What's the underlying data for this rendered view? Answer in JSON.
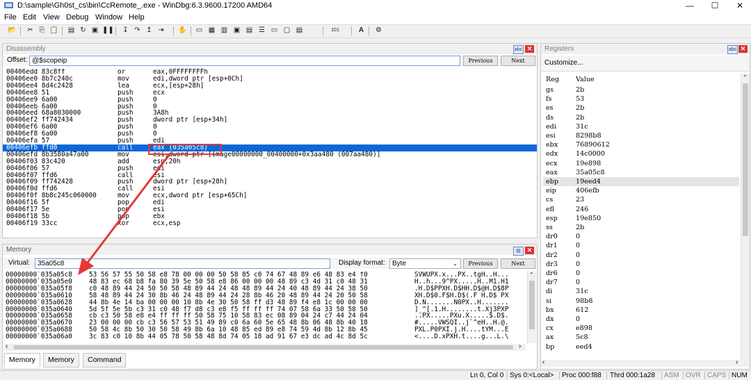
{
  "window": {
    "title": "D:\\sample\\Gh0st_cs\\bin\\CcRemote_.exe - WinDbg:6.3.9600.17200 AMD64",
    "minimize": "—",
    "maximize": "☐",
    "close": "✕"
  },
  "menu": [
    "File",
    "Edit",
    "View",
    "Debug",
    "Window",
    "Help"
  ],
  "toolbar": {
    "icons": [
      "open-icon",
      "cut-icon",
      "copy-icon",
      "paste-icon",
      "go-icon",
      "restart-icon",
      "stop-icon",
      "break-icon",
      "step-into-icon",
      "step-over-icon",
      "step-out-icon",
      "run-to-cursor-icon",
      "hand-icon",
      "command-window-icon",
      "watch-window-icon",
      "locals-window-icon",
      "registers-window-icon",
      "memory-window-icon",
      "call-stack-icon",
      "disassembly-icon",
      "scratch-pad-icon",
      "process-threads-icon",
      "source-mode-icon",
      "font-icon",
      "options-icon"
    ],
    "source_mode_label": "101",
    "font_label": "A",
    "options_label": "⚙"
  },
  "disassembly": {
    "header": "Disassembly",
    "offset_label": "Offset:",
    "offset_value": "@$scopeip",
    "previous": "Previous",
    "next": "Next",
    "selected_index": 11,
    "callout_text": "eax {035a05c8}",
    "lines": [
      {
        "addr": "00406edd 83c8ff",
        "mn": "or",
        "op": "eax,0FFFFFFFFh"
      },
      {
        "addr": "00406ee0 8b7c240c",
        "mn": "mov",
        "op": "edi,dword ptr [esp+0Ch]"
      },
      {
        "addr": "00406ee4 8d4c2428",
        "mn": "lea",
        "op": "ecx,[esp+28h]"
      },
      {
        "addr": "00406ee8 51",
        "mn": "push",
        "op": "ecx"
      },
      {
        "addr": "00406ee9 6a00",
        "mn": "push",
        "op": "0"
      },
      {
        "addr": "00406eeb 6a00",
        "mn": "push",
        "op": "0"
      },
      {
        "addr": "00406eed 68a8030000",
        "mn": "push",
        "op": "3A8h"
      },
      {
        "addr": "00406ef2 ff742434",
        "mn": "push",
        "op": "dword ptr [esp+34h]"
      },
      {
        "addr": "00406ef6 6a00",
        "mn": "push",
        "op": "0"
      },
      {
        "addr": "00406ef8 6a00",
        "mn": "push",
        "op": "0"
      },
      {
        "addr": "00406efa 57",
        "mn": "push",
        "op": "edi"
      },
      {
        "addr": "00406efb ffd0",
        "mn": "call",
        "op": "eax {035a05c8}"
      },
      {
        "addr": "00406efd 8b3580a47a00",
        "mn": "mov",
        "op": "esi,dword ptr [image00000000_00400000+0x3aa480 (007aa480)]"
      },
      {
        "addr": "00406f03 83c420",
        "mn": "add",
        "op": "esp,20h"
      },
      {
        "addr": "00406f06 57",
        "mn": "push",
        "op": "edi"
      },
      {
        "addr": "00406f07 ffd6",
        "mn": "call",
        "op": "esi"
      },
      {
        "addr": "00406f09 ff742428",
        "mn": "push",
        "op": "dword ptr [esp+28h]"
      },
      {
        "addr": "00406f0d ffd6",
        "mn": "call",
        "op": "esi"
      },
      {
        "addr": "00406f0f 8b8c245c060000",
        "mn": "mov",
        "op": "ecx,dword ptr [esp+65Ch]"
      },
      {
        "addr": "00406f16 5f",
        "mn": "pop",
        "op": "edi"
      },
      {
        "addr": "00406f17 5e",
        "mn": "pop",
        "op": "esi"
      },
      {
        "addr": "00406f18 5b",
        "mn": "pop",
        "op": "ebx"
      },
      {
        "addr": "00406f19 33cc",
        "mn": "xor",
        "op": "ecx,esp"
      }
    ]
  },
  "memory": {
    "header": "Memory",
    "virtual_label": "Virtual:",
    "virtual_value": "35a05c8",
    "display_format_label": "Display format:",
    "display_format_value": "Byte",
    "previous": "Previous",
    "next": "Next",
    "rows": [
      {
        "addr": "00000000`035a05c8",
        "hex": "53 56 57 55 50 58 e8 78 00 00 00 50 58 85 c0 74 67 48 89 e6 48 83 e4 f0",
        "ascii": "SVWUPX.x...PX..tgH..H..."
      },
      {
        "addr": "00000000`035a05e0",
        "hex": "48 83 ec 68 b8 fa 80 39 5e 50 58 e8 86 00 00 00 48 89 c3 4d 31 c0 48 31",
        "ascii": "H..h...9^PX.....H..M1.H1"
      },
      {
        "addr": "00000000`035a05f8",
        "hex": "c0 48 89 44 24 50 50 58 48 89 44 24 48 48 89 44 24 40 48 89 44 24 38 50",
        "ascii": ".H.D$PPXH.D$HH.D$@H.D$8P"
      },
      {
        "addr": "00000000`035a0610",
        "hex": "58 48 89 44 24 30 8b 46 24 48 89 44 24 28 8b 46 20 48 89 44 24 20 50 58",
        "ascii": "XH.D$0.F$H.D$(.F H.D$ PX"
      },
      {
        "addr": "00000000`035a0628",
        "hex": "44 8b 4e 14 ba 00 00 00 10 8b 4e 30 50 58 ff d3 48 89 f4 e8 1c 00 00 00",
        "ascii": "D.N.......N0PX..H......."
      },
      {
        "addr": "00000000`035a0640",
        "hex": "5d 5f 5e 5b c3 31 c0 48 f7 d8 c3 e8 f5 ff ff ff 74 07 58 6a 33 50 58 50",
        "ascii": "]_^[.1.H........t.Xj3PXP"
      },
      {
        "addr": "00000000`035a0658",
        "hex": "cb c3 50 58 e8 e4 ff ff ff 50 58 75 10 58 83 ec 08 89 04 24 c7 44 24 04",
        "ascii": "..PX.....PXu.X.....$.D$."
      },
      {
        "addr": "00000000`035a0670",
        "hex": "23 00 00 00 cb c3 56 57 53 51 49 89 c0 6a 60 5e 65 48 8b 06 48 8b 40 18",
        "ascii": "#.....VWSQI..j`^eH..H.@."
      },
      {
        "addr": "00000000`035a0688",
        "hex": "50 58 4c 8b 50 30 50 58 49 8b 6a 10 48 85 ed 89 e8 74 59 4d 8b 12 8b 45",
        "ascii": "PXL.P0PXI.j.H....tYM...E"
      },
      {
        "addr": "00000000`035a06a0",
        "hex": "3c 83 c0 10 8b 44 05 78 50 58 48 8d 74 05 18 ad 91 67 e3 dc ad 4c 8d 5c",
        "ascii": "<....D.xPXH.t....g...L.\\"
      }
    ]
  },
  "registers": {
    "header": "Registers",
    "customize": "Customize...",
    "col_reg": "Reg",
    "col_value": "Value",
    "selected_index": 10,
    "rows": [
      {
        "reg": "gs",
        "val": "2b"
      },
      {
        "reg": "fs",
        "val": "53"
      },
      {
        "reg": "es",
        "val": "2b"
      },
      {
        "reg": "ds",
        "val": "2b"
      },
      {
        "reg": "edi",
        "val": "31c"
      },
      {
        "reg": "esi",
        "val": "8298b8"
      },
      {
        "reg": "ebx",
        "val": "76890612"
      },
      {
        "reg": "edx",
        "val": "14c0000"
      },
      {
        "reg": "ecx",
        "val": "19e898"
      },
      {
        "reg": "eax",
        "val": "35a05c8"
      },
      {
        "reg": "ebp",
        "val": "19eed4"
      },
      {
        "reg": "eip",
        "val": "406efb"
      },
      {
        "reg": "cs",
        "val": "23"
      },
      {
        "reg": "efl",
        "val": "246"
      },
      {
        "reg": "esp",
        "val": "19e850"
      },
      {
        "reg": "ss",
        "val": "2b"
      },
      {
        "reg": "dr0",
        "val": "0"
      },
      {
        "reg": "dr1",
        "val": "0"
      },
      {
        "reg": "dr2",
        "val": "0"
      },
      {
        "reg": "dr3",
        "val": "0"
      },
      {
        "reg": "dr6",
        "val": "0"
      },
      {
        "reg": "dr7",
        "val": "0"
      },
      {
        "reg": "di",
        "val": "31c"
      },
      {
        "reg": "si",
        "val": "98b8"
      },
      {
        "reg": "bx",
        "val": "612"
      },
      {
        "reg": "dx",
        "val": "0"
      },
      {
        "reg": "cx",
        "val": "e898"
      },
      {
        "reg": "ax",
        "val": "5c8"
      },
      {
        "reg": "bp",
        "val": "eed4"
      }
    ]
  },
  "tabs": [
    "Memory",
    "Memory",
    "Command"
  ],
  "status": {
    "position": "Ln 0, Col 0",
    "sys": "Sys 0:<Local>",
    "proc": "Proc 000:f88",
    "thrd": "Thrd 000:1a28",
    "asm": "ASM",
    "ovr": "OVR",
    "caps": "CAPS",
    "num": "NUM"
  },
  "colors": {
    "selection": "#0a68d8",
    "annotation": "#e53935"
  }
}
